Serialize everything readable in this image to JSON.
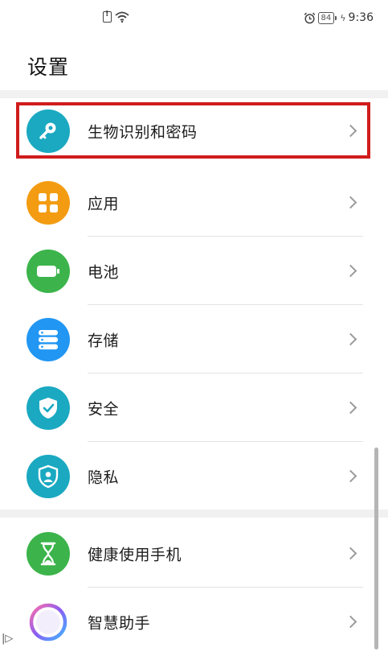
{
  "status_bar": {
    "battery_level": "84",
    "time": "9:36",
    "icons": [
      "sim-alert-icon",
      "wifi-icon",
      "alarm-icon",
      "battery-icon",
      "charging-icon"
    ]
  },
  "page": {
    "title": "设置"
  },
  "settings_items": [
    {
      "label": "生物识别和密码",
      "icon": "key-icon",
      "color": "#1aa9c1",
      "highlighted": true
    },
    {
      "label": "应用",
      "icon": "apps-grid-icon",
      "color": "#f39c12"
    },
    {
      "label": "电池",
      "icon": "battery-icon",
      "color": "#3cb44b"
    },
    {
      "label": "存储",
      "icon": "storage-icon",
      "color": "#2196f3"
    },
    {
      "label": "安全",
      "icon": "shield-check-icon",
      "color": "#1aa9c1"
    },
    {
      "label": "隐私",
      "icon": "privacy-shield-icon",
      "color": "#1aa9c1"
    },
    {
      "label": "健康使用手机",
      "icon": "hourglass-icon",
      "color": "#3cb44b"
    },
    {
      "label": "智慧助手",
      "icon": "assistant-orb-icon",
      "color": "#8a5cf6"
    }
  ],
  "colors": {
    "highlight_border": "#d01c1c"
  }
}
